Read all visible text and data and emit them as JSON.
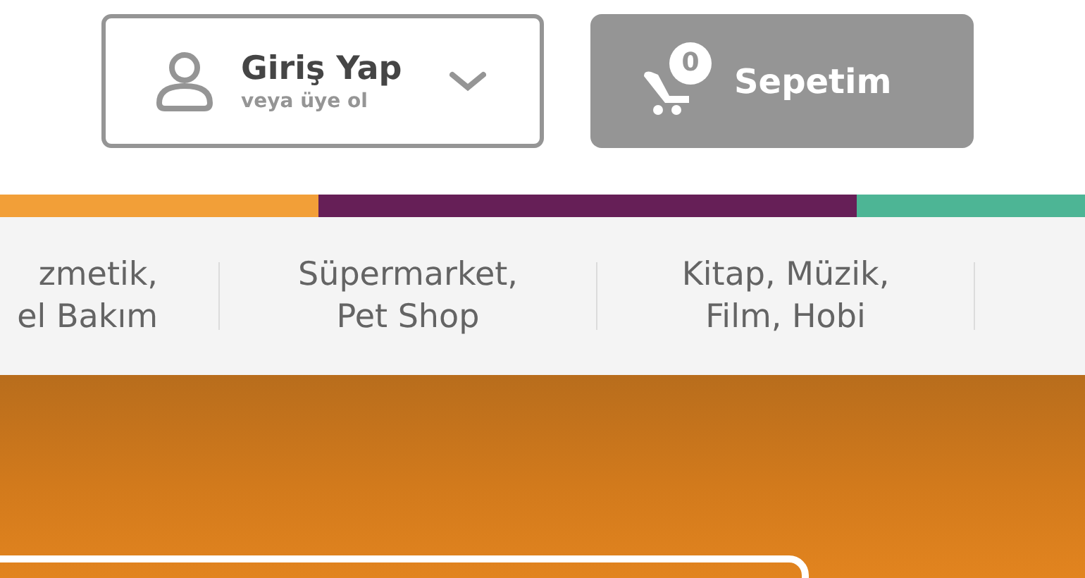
{
  "header": {
    "login": {
      "title": "Giriş Yap",
      "subtitle": "veya üye ol"
    },
    "cart": {
      "count": "0",
      "label": "Sepetim"
    }
  },
  "color_bar": [
    {
      "color": "#f29f38"
    },
    {
      "color": "#661f57"
    },
    {
      "color": "#4db595"
    }
  ],
  "categories": [
    {
      "lines": [
        "zmetik,",
        "el Bakım"
      ]
    },
    {
      "lines": [
        "Süpermarket,",
        "Pet Shop"
      ]
    },
    {
      "lines": [
        "Kitap, Müzik,",
        "Film, Hobi"
      ]
    }
  ]
}
